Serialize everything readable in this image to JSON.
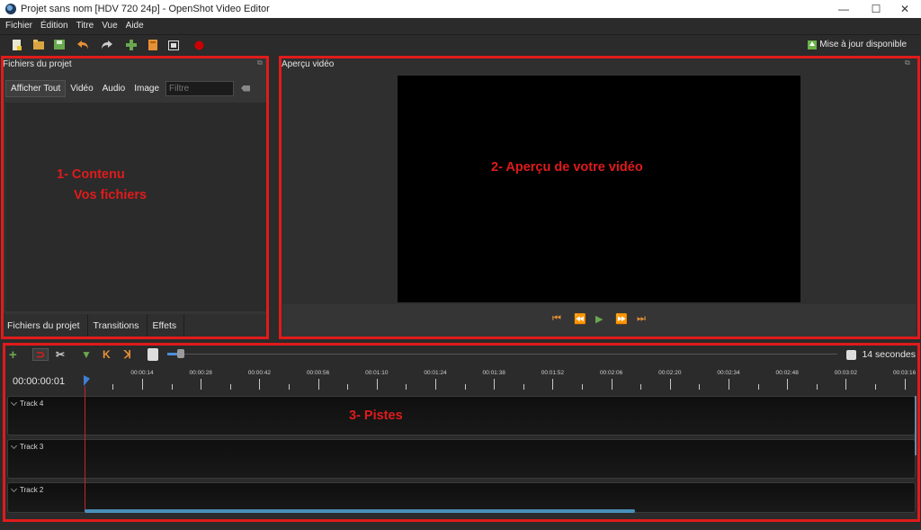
{
  "window": {
    "title": "Projet sans nom [HDV 720 24p] - OpenShot Video Editor",
    "controls": [
      "—",
      "☐",
      "✕"
    ]
  },
  "menu": [
    "Fichier",
    "Édition",
    "Titre",
    "Vue",
    "Aide"
  ],
  "toolbar": {
    "buttons": [
      {
        "icon": "new-project-icon",
        "color": "#e8e8d0"
      },
      {
        "icon": "open-project-icon",
        "color": "#d9a441"
      },
      {
        "icon": "save-project-icon",
        "color": "#6aa84f"
      },
      {
        "icon": "undo-icon",
        "color": "#e69138"
      },
      {
        "icon": "redo-icon",
        "color": "#cccccc"
      },
      {
        "icon": "import-files-icon",
        "color": "#6aa84f"
      },
      {
        "icon": "choose-profile-icon",
        "color": "#e69138"
      },
      {
        "icon": "fullscreen-icon",
        "color": "#dddddd"
      },
      {
        "icon": "export-video-icon",
        "color": "#cc0000"
      }
    ],
    "update_label": "Mise à jour disponible"
  },
  "project_files": {
    "title": "Fichiers du projet",
    "filters": [
      "Afficher Tout",
      "Vidéo",
      "Audio",
      "Image"
    ],
    "active_filter": "Afficher Tout",
    "filter_placeholder": "Filtre",
    "bottom_tabs": [
      "Fichiers du projet",
      "Transitions",
      "Effets"
    ]
  },
  "preview": {
    "title": "Aperçu vidéo"
  },
  "timeline": {
    "zoom_label": "14 secondes",
    "timecode": "00:00:00:01",
    "ruler_labels": [
      "00:00:14",
      "00:00:28",
      "00:00:42",
      "00:00:56",
      "00:01:10",
      "00:01:24",
      "00:01:38",
      "00:01:52",
      "00:02:06",
      "00:02:20",
      "00:02:34",
      "00:02:48",
      "00:03:02",
      "00:03:16"
    ],
    "tracks": [
      "Track 4",
      "Track 3",
      "Track 2"
    ],
    "zoom_level": 0.02
  },
  "annotations": {
    "box1_line1": "1- Contenu",
    "box1_line2": "Vos fichiers",
    "box2": "2- Aperçu de votre vidéo",
    "box3": "3-  Pistes",
    "color": "#e01b1b"
  }
}
